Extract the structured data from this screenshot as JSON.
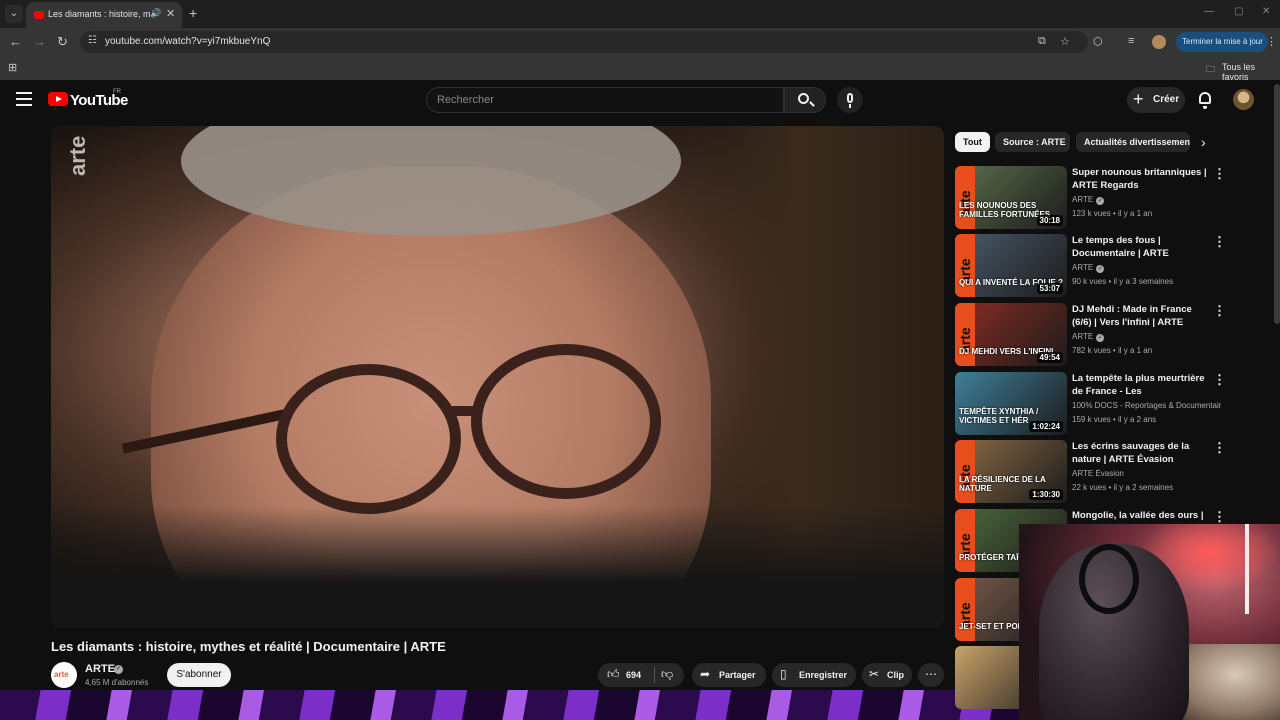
{
  "browser": {
    "tab_title": "Les diamants : histoire, myth",
    "url": "youtube.com/watch?v=yi7mkbueYnQ",
    "update_button": "Terminer la mise à jour",
    "bookmarks_folder": "Tous les favoris"
  },
  "youtube": {
    "logo_text": "YouTube",
    "country_code": "FR",
    "search_placeholder": "Rechercher",
    "create_label": "Créer"
  },
  "player": {
    "watermark": "arte"
  },
  "video": {
    "title": "Les diamants : histoire, mythes et réalité | Documentaire | ARTE",
    "channel_name": "ARTE",
    "channel_logo": "arte",
    "subscribers": "4,65 M d'abonnés",
    "subscribe_label": "S'abonner",
    "likes": "694",
    "share_label": "Partager",
    "save_label": "Enregistrer",
    "clip_label": "Clip"
  },
  "chips": [
    {
      "label": "Tout",
      "active": true
    },
    {
      "label": "Source : ARTE",
      "active": false
    },
    {
      "label": "Actualités divertissement",
      "active": false
    }
  ],
  "recommendations": [
    {
      "title": "Super nounous britanniques | ARTE Regards",
      "channel": "ARTE",
      "verified": true,
      "meta": "123 k vues • il y a 1 an",
      "duration": "30:18",
      "thumb_text": "LES NOUNOUS DES FAMILLES FORTUNÉES",
      "thumb_color": "#5b6e4a"
    },
    {
      "title": "Le temps des fous | Documentaire | ARTE",
      "channel": "ARTE",
      "verified": true,
      "meta": "90 k vues • il y a 3 semaines",
      "duration": "53:07",
      "thumb_text": "QUI A INVENTÉ LA FOLIE ?",
      "thumb_color": "#4a5a6b"
    },
    {
      "title": "DJ Mehdi : Made in France (6/6) | Vers l'infini | ARTE",
      "channel": "ARTE",
      "verified": true,
      "meta": "782 k vues • il y a 1 an",
      "duration": "49:54",
      "thumb_text": "DJ MEHDI VERS L'INFINI",
      "thumb_color": "#8a2c22"
    },
    {
      "title": "La tempête la plus meurtrière de France - Les conséquences...",
      "channel": "100% DOCS - Reportages & Documentair...",
      "verified": false,
      "meta": "159 k vues • il y a 2 ans",
      "duration": "1:02:24",
      "thumb_text": "TEMPÊTE XYNTHIA / VICTIMES ET HÉR",
      "thumb_color": "#3f7f9a"
    },
    {
      "title": "Les écrins sauvages de la nature | ARTE Évasion",
      "channel": "ARTE Évasion",
      "verified": false,
      "meta": "22 k vues • il y a 2 semaines",
      "duration": "1:30:30",
      "thumb_text": "LA RÉSILIENCE DE LA NATURE",
      "thumb_color": "#8a6b45"
    },
    {
      "title": "Mongolie, la vallée des ours |",
      "channel": "",
      "verified": false,
      "meta": "",
      "duration": "",
      "thumb_text": "PROTÉGER TAÏGA RO",
      "thumb_color": "#4d6a3b"
    },
    {
      "title": "",
      "channel": "",
      "verified": false,
      "meta": "",
      "duration": "",
      "thumb_text": "JET-SET ET PORN",
      "thumb_color": "#7a5a4a"
    },
    {
      "title": "",
      "channel": "",
      "verified": false,
      "meta": "",
      "duration": "",
      "thumb_text": "",
      "thumb_color": "#c9a36a"
    }
  ],
  "colors": {
    "background": "#0f0f0f",
    "arte_orange": "#e84e1b",
    "yt_red": "#ff0000",
    "update_blue": "#1a4e7e"
  }
}
